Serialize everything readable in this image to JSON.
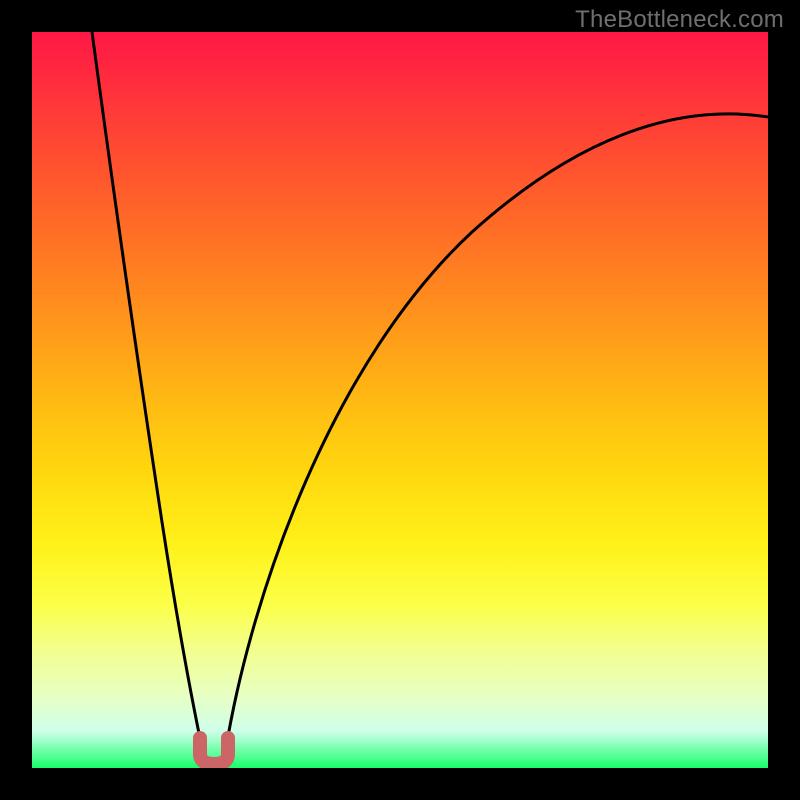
{
  "watermark": "TheBottleneck.com",
  "chart_data": {
    "type": "line",
    "title": "",
    "xlabel": "",
    "ylabel": "",
    "xlim": [
      0,
      100
    ],
    "ylim": [
      0,
      100
    ],
    "gradient_stops": [
      {
        "pct": 0,
        "color": "#ff1846"
      },
      {
        "pct": 14,
        "color": "#ff4434"
      },
      {
        "pct": 36,
        "color": "#ff8a1e"
      },
      {
        "pct": 60,
        "color": "#ffd80e"
      },
      {
        "pct": 78,
        "color": "#fcff4a"
      },
      {
        "pct": 90,
        "color": "#e8ffc2"
      },
      {
        "pct": 100,
        "color": "#18ff6a"
      }
    ],
    "series": [
      {
        "name": "left-branch",
        "x": [
          8,
          10,
          12,
          14,
          16,
          18,
          20,
          22,
          23.5
        ],
        "y": [
          100,
          88,
          77,
          65,
          52,
          38,
          24,
          10,
          2
        ],
        "note": "steep descending branch from top-left toward the cusp"
      },
      {
        "name": "right-branch",
        "x": [
          26,
          28,
          32,
          38,
          46,
          56,
          68,
          82,
          100
        ],
        "y": [
          2,
          12,
          28,
          44,
          58,
          69,
          78,
          84,
          88
        ],
        "note": "concave ascending branch from cusp toward top-right"
      }
    ],
    "cusp_marker": {
      "x": 24.5,
      "y": 1.5,
      "width": 3,
      "color": "#cc6666",
      "shape": "U"
    }
  }
}
